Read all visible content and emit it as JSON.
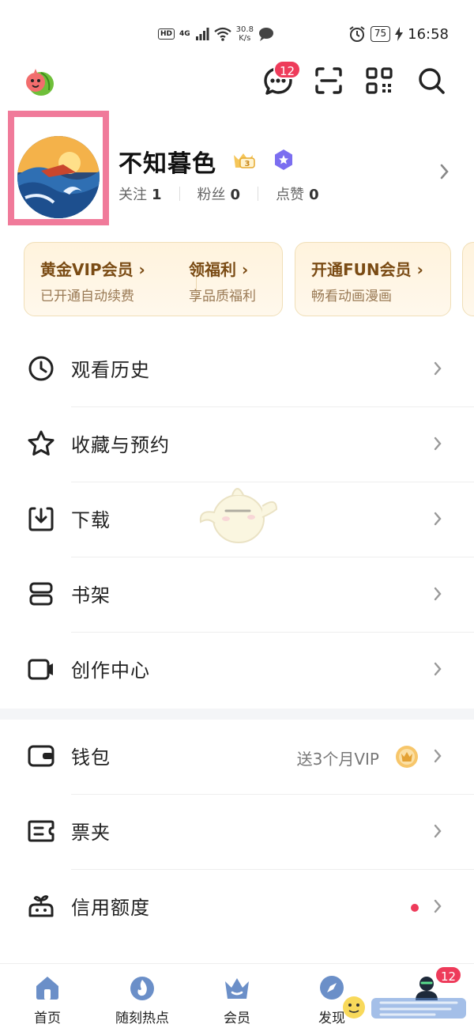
{
  "status_bar": {
    "network": "4G",
    "hd": "HD",
    "speed_top": "30.8",
    "speed_bottom": "K/s",
    "battery": "75",
    "time": "16:58"
  },
  "header": {
    "message_badge": "12"
  },
  "profile": {
    "username": "不知暮色",
    "level_badge": "LV3",
    "stats": [
      {
        "label": "关注",
        "value": "1"
      },
      {
        "label": "粉丝",
        "value": "0"
      },
      {
        "label": "点赞",
        "value": "0"
      }
    ]
  },
  "vip": {
    "gold_title": "黄金VIP会员 ›",
    "gold_sub": "已开通自动续费",
    "welfare_title": "领福利 ›",
    "welfare_sub": "享品质福利",
    "fun_title": "开通FUN会员 ›",
    "fun_sub": "畅看动画漫画"
  },
  "menu": [
    {
      "label": "观看历史",
      "icon": "clock-icon"
    },
    {
      "label": "收藏与预约",
      "icon": "star-icon"
    },
    {
      "label": "下载",
      "icon": "download-icon"
    },
    {
      "label": "书架",
      "icon": "bookshelf-icon"
    },
    {
      "label": "创作中心",
      "icon": "video-camera-icon"
    }
  ],
  "menu2": [
    {
      "label": "钱包",
      "icon": "wallet-icon",
      "extra": "送3个月VIP"
    },
    {
      "label": "票夹",
      "icon": "ticket-icon"
    },
    {
      "label": "信用额度",
      "icon": "credit-icon"
    }
  ],
  "bottom_nav": {
    "items": [
      {
        "label": "首页"
      },
      {
        "label": "随刻热点"
      },
      {
        "label": "会员"
      },
      {
        "label": "发现"
      }
    ],
    "me_badge": "12"
  },
  "colors": {
    "accent_pink": "#f07a9a",
    "badge_red": "#ee3b5a",
    "gold_text": "#7a4b14",
    "nav_blue": "#6b8fc8"
  }
}
